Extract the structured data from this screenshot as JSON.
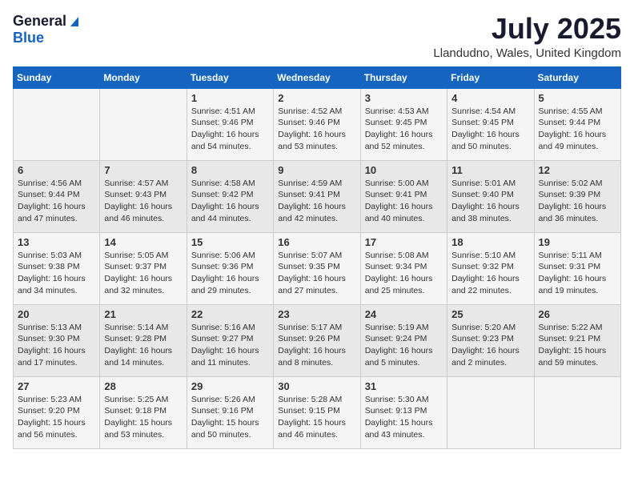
{
  "header": {
    "logo_general": "General",
    "logo_blue": "Blue",
    "month_title": "July 2025",
    "location": "Llandudno, Wales, United Kingdom"
  },
  "days_of_week": [
    "Sunday",
    "Monday",
    "Tuesday",
    "Wednesday",
    "Thursday",
    "Friday",
    "Saturday"
  ],
  "weeks": [
    [
      {
        "day": "",
        "content": ""
      },
      {
        "day": "",
        "content": ""
      },
      {
        "day": "1",
        "content": "Sunrise: 4:51 AM\nSunset: 9:46 PM\nDaylight: 16 hours\nand 54 minutes."
      },
      {
        "day": "2",
        "content": "Sunrise: 4:52 AM\nSunset: 9:46 PM\nDaylight: 16 hours\nand 53 minutes."
      },
      {
        "day": "3",
        "content": "Sunrise: 4:53 AM\nSunset: 9:45 PM\nDaylight: 16 hours\nand 52 minutes."
      },
      {
        "day": "4",
        "content": "Sunrise: 4:54 AM\nSunset: 9:45 PM\nDaylight: 16 hours\nand 50 minutes."
      },
      {
        "day": "5",
        "content": "Sunrise: 4:55 AM\nSunset: 9:44 PM\nDaylight: 16 hours\nand 49 minutes."
      }
    ],
    [
      {
        "day": "6",
        "content": "Sunrise: 4:56 AM\nSunset: 9:44 PM\nDaylight: 16 hours\nand 47 minutes."
      },
      {
        "day": "7",
        "content": "Sunrise: 4:57 AM\nSunset: 9:43 PM\nDaylight: 16 hours\nand 46 minutes."
      },
      {
        "day": "8",
        "content": "Sunrise: 4:58 AM\nSunset: 9:42 PM\nDaylight: 16 hours\nand 44 minutes."
      },
      {
        "day": "9",
        "content": "Sunrise: 4:59 AM\nSunset: 9:41 PM\nDaylight: 16 hours\nand 42 minutes."
      },
      {
        "day": "10",
        "content": "Sunrise: 5:00 AM\nSunset: 9:41 PM\nDaylight: 16 hours\nand 40 minutes."
      },
      {
        "day": "11",
        "content": "Sunrise: 5:01 AM\nSunset: 9:40 PM\nDaylight: 16 hours\nand 38 minutes."
      },
      {
        "day": "12",
        "content": "Sunrise: 5:02 AM\nSunset: 9:39 PM\nDaylight: 16 hours\nand 36 minutes."
      }
    ],
    [
      {
        "day": "13",
        "content": "Sunrise: 5:03 AM\nSunset: 9:38 PM\nDaylight: 16 hours\nand 34 minutes."
      },
      {
        "day": "14",
        "content": "Sunrise: 5:05 AM\nSunset: 9:37 PM\nDaylight: 16 hours\nand 32 minutes."
      },
      {
        "day": "15",
        "content": "Sunrise: 5:06 AM\nSunset: 9:36 PM\nDaylight: 16 hours\nand 29 minutes."
      },
      {
        "day": "16",
        "content": "Sunrise: 5:07 AM\nSunset: 9:35 PM\nDaylight: 16 hours\nand 27 minutes."
      },
      {
        "day": "17",
        "content": "Sunrise: 5:08 AM\nSunset: 9:34 PM\nDaylight: 16 hours\nand 25 minutes."
      },
      {
        "day": "18",
        "content": "Sunrise: 5:10 AM\nSunset: 9:32 PM\nDaylight: 16 hours\nand 22 minutes."
      },
      {
        "day": "19",
        "content": "Sunrise: 5:11 AM\nSunset: 9:31 PM\nDaylight: 16 hours\nand 19 minutes."
      }
    ],
    [
      {
        "day": "20",
        "content": "Sunrise: 5:13 AM\nSunset: 9:30 PM\nDaylight: 16 hours\nand 17 minutes."
      },
      {
        "day": "21",
        "content": "Sunrise: 5:14 AM\nSunset: 9:28 PM\nDaylight: 16 hours\nand 14 minutes."
      },
      {
        "day": "22",
        "content": "Sunrise: 5:16 AM\nSunset: 9:27 PM\nDaylight: 16 hours\nand 11 minutes."
      },
      {
        "day": "23",
        "content": "Sunrise: 5:17 AM\nSunset: 9:26 PM\nDaylight: 16 hours\nand 8 minutes."
      },
      {
        "day": "24",
        "content": "Sunrise: 5:19 AM\nSunset: 9:24 PM\nDaylight: 16 hours\nand 5 minutes."
      },
      {
        "day": "25",
        "content": "Sunrise: 5:20 AM\nSunset: 9:23 PM\nDaylight: 16 hours\nand 2 minutes."
      },
      {
        "day": "26",
        "content": "Sunrise: 5:22 AM\nSunset: 9:21 PM\nDaylight: 15 hours\nand 59 minutes."
      }
    ],
    [
      {
        "day": "27",
        "content": "Sunrise: 5:23 AM\nSunset: 9:20 PM\nDaylight: 15 hours\nand 56 minutes."
      },
      {
        "day": "28",
        "content": "Sunrise: 5:25 AM\nSunset: 9:18 PM\nDaylight: 15 hours\nand 53 minutes."
      },
      {
        "day": "29",
        "content": "Sunrise: 5:26 AM\nSunset: 9:16 PM\nDaylight: 15 hours\nand 50 minutes."
      },
      {
        "day": "30",
        "content": "Sunrise: 5:28 AM\nSunset: 9:15 PM\nDaylight: 15 hours\nand 46 minutes."
      },
      {
        "day": "31",
        "content": "Sunrise: 5:30 AM\nSunset: 9:13 PM\nDaylight: 15 hours\nand 43 minutes."
      },
      {
        "day": "",
        "content": ""
      },
      {
        "day": "",
        "content": ""
      }
    ]
  ]
}
